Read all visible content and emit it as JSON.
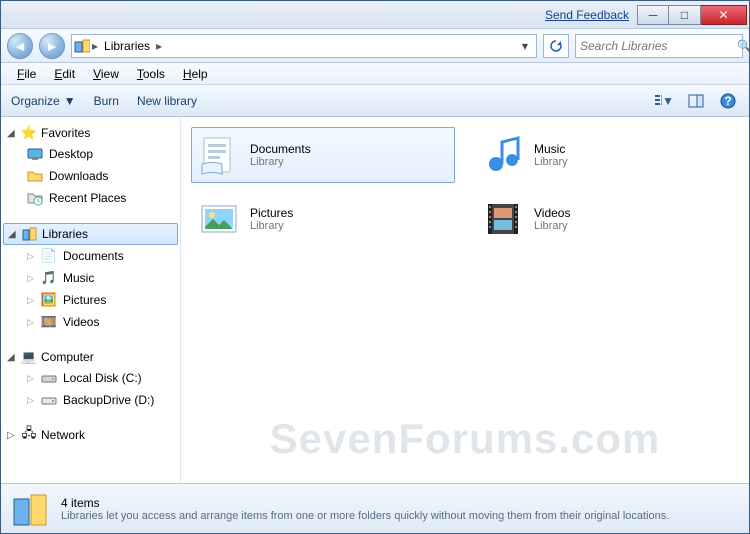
{
  "titlebar": {
    "feedback": "Send Feedback"
  },
  "nav": {
    "breadcrumb": [
      "Libraries"
    ],
    "search_placeholder": "Search Libraries"
  },
  "menu": {
    "items": [
      "File",
      "Edit",
      "View",
      "Tools",
      "Help"
    ]
  },
  "toolbar": {
    "organize": "Organize",
    "burn": "Burn",
    "newlib": "New library"
  },
  "sidebar": {
    "favorites": {
      "label": "Favorites",
      "items": [
        {
          "label": "Desktop",
          "icon": "desktop"
        },
        {
          "label": "Downloads",
          "icon": "folder"
        },
        {
          "label": "Recent Places",
          "icon": "recent"
        }
      ]
    },
    "libraries": {
      "label": "Libraries",
      "items": [
        {
          "label": "Documents",
          "icon": "doc"
        },
        {
          "label": "Music",
          "icon": "music"
        },
        {
          "label": "Pictures",
          "icon": "pic"
        },
        {
          "label": "Videos",
          "icon": "vid"
        }
      ]
    },
    "computer": {
      "label": "Computer",
      "items": [
        {
          "label": "Local Disk (C:)",
          "icon": "drive"
        },
        {
          "label": "BackupDrive (D:)",
          "icon": "drive2"
        }
      ]
    },
    "network": {
      "label": "Network"
    }
  },
  "content": {
    "sub": "Library",
    "items": [
      {
        "name": "Documents",
        "icon": "doc"
      },
      {
        "name": "Music",
        "icon": "music"
      },
      {
        "name": "Pictures",
        "icon": "pic"
      },
      {
        "name": "Videos",
        "icon": "vid"
      }
    ]
  },
  "details": {
    "count": "4 items",
    "desc": "Libraries let you access and arrange items from one or more folders quickly without moving them from their original locations."
  },
  "watermark": "SevenForums.com"
}
